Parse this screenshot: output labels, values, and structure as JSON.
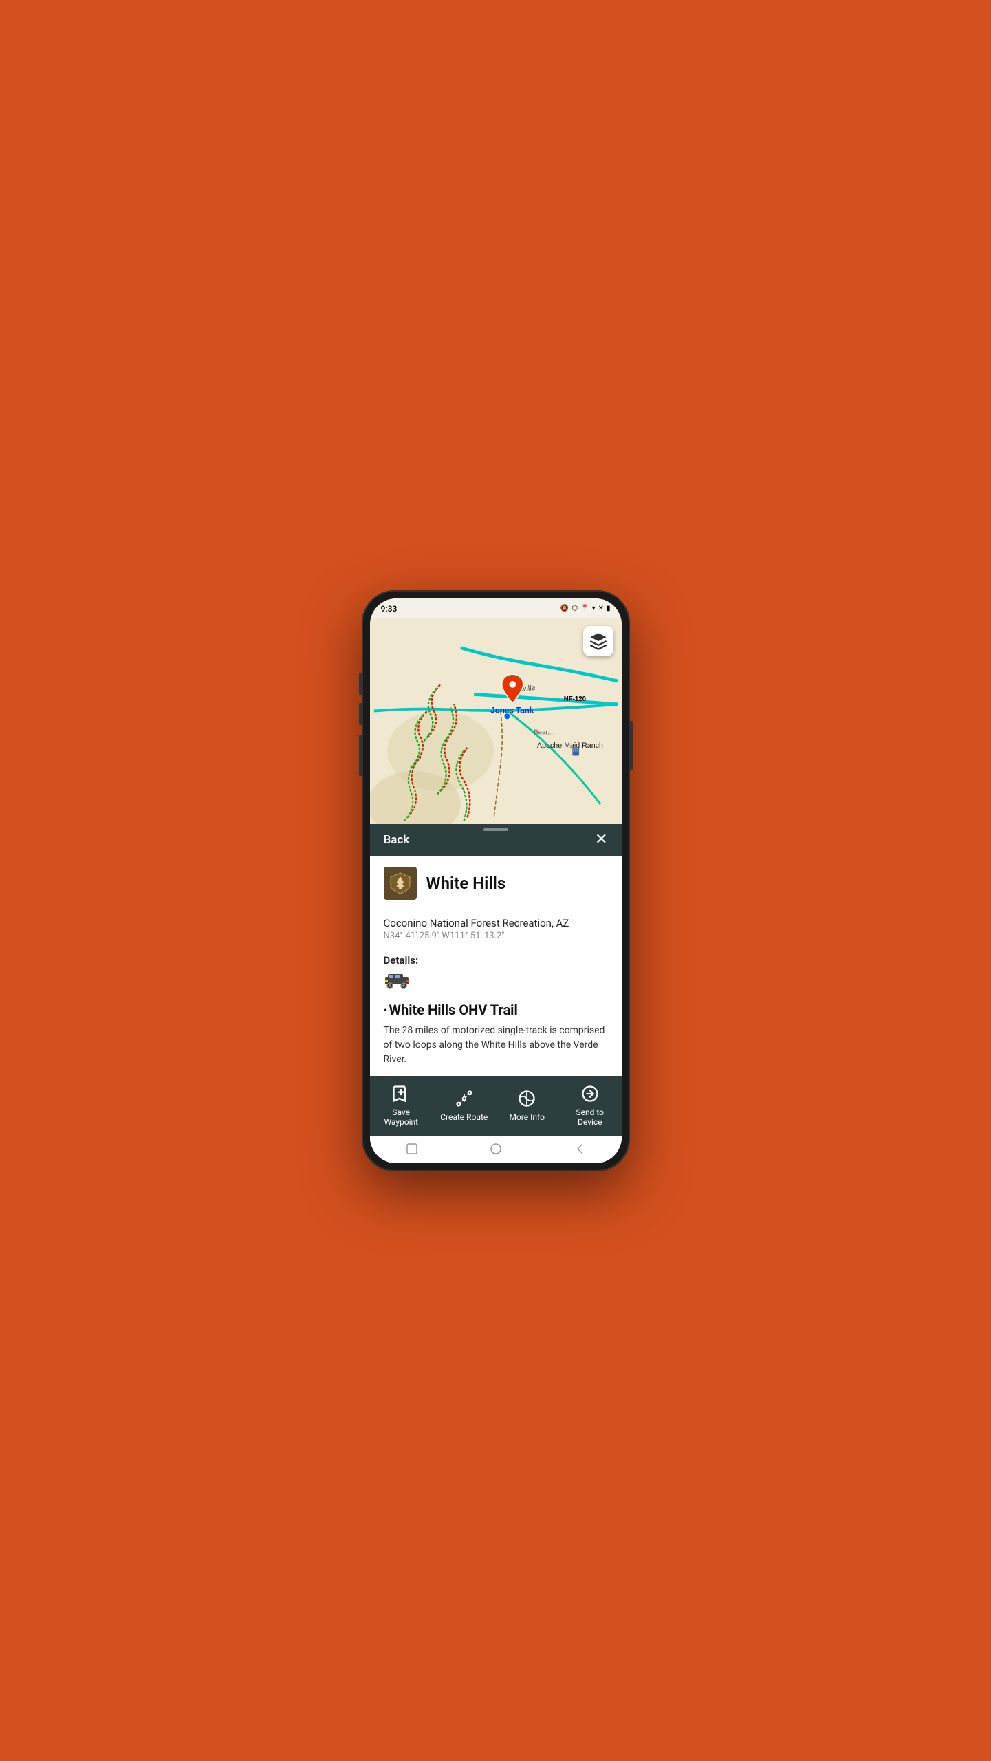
{
  "status_bar": {
    "time": "9:33",
    "icons": [
      "signal",
      "bluetooth",
      "location",
      "wifi",
      "no-signal1",
      "no-signal2",
      "battery"
    ]
  },
  "map": {
    "location_name": "Jones Tank",
    "road_labels": [
      "Cornville",
      "NF-120",
      "Bear..."
    ],
    "poi_label": "Apache Maid Ranch"
  },
  "panel": {
    "back_label": "Back",
    "close_label": "✕",
    "place_name": "White Hills",
    "forest_service": "USFS",
    "location": "Coconino National Forest Recreation, AZ",
    "coordinates": "N34° 41' 25.9\" W111° 51' 13.2\"",
    "details_label": "Details:",
    "trail_title": "White Hills OHV Trail",
    "trail_description": "The 28 miles of motorized single-track is comprised of two loops along the White Hills above the Verde River."
  },
  "actions": [
    {
      "id": "save-waypoint",
      "icon": "bookmark-plus",
      "label": "Save\nWaypoint"
    },
    {
      "id": "create-route",
      "icon": "route",
      "label": "Create Route"
    },
    {
      "id": "more-info",
      "icon": "globe",
      "label": "More Info"
    },
    {
      "id": "send-to-device",
      "icon": "navigate",
      "label": "Send to\nDevice"
    }
  ],
  "android_nav": {
    "square": "□",
    "circle": "○",
    "back": "◁"
  }
}
